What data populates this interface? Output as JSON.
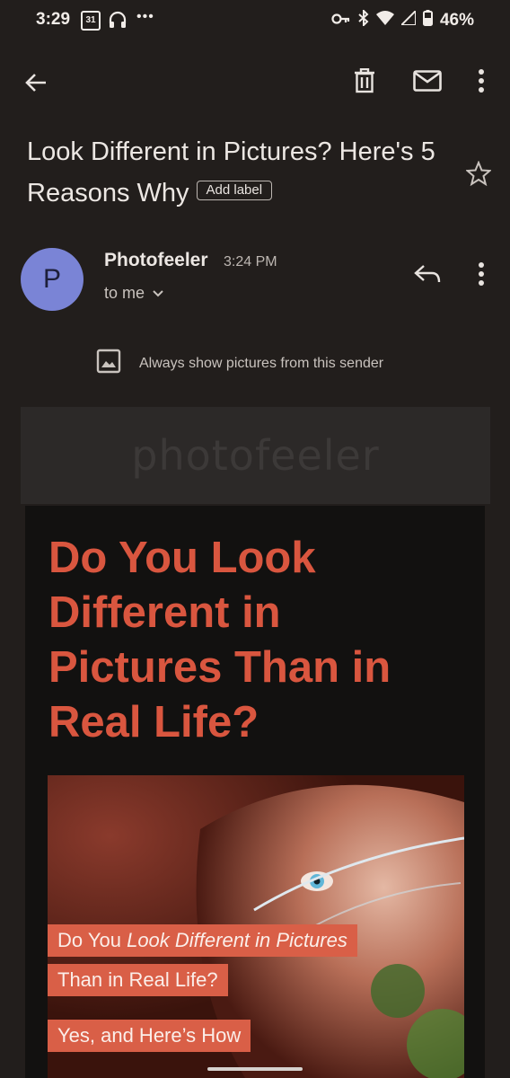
{
  "status_bar": {
    "time": "3:29",
    "calendar_day": "31",
    "battery": "46%",
    "icons": [
      "calendar-icon",
      "headset-icon",
      "more-notifications-icon",
      "vpn-key-icon",
      "bluetooth-icon",
      "wifi-icon",
      "signal-icon",
      "battery-icon"
    ]
  },
  "toolbar": {
    "icons": [
      "back-arrow-icon",
      "delete-icon",
      "mark-unread-icon",
      "more-options-icon"
    ]
  },
  "email": {
    "subject": "Look Different in Pictures? Here's 5 Reasons Why",
    "label_chip": "Add label",
    "sender_initial": "P",
    "sender_name": "Photofeeler",
    "time": "3:24 PM",
    "recipient": "to me",
    "show_pictures": "Always show pictures from this sender"
  },
  "body": {
    "banner_text": "photofeeler",
    "headline": "Do You Look Different in Pictures Than in Real Life?",
    "image_tags": {
      "line1_prefix": "Do You ",
      "line1_italic": "Look Different in Pictures",
      "line2": "Than in Real Life?",
      "line3": "Yes, and Here’s How"
    }
  },
  "colors": {
    "background": "#221e1c",
    "avatar": "#7a84d6",
    "headline": "#d9563f",
    "tag": "#d95f47"
  }
}
